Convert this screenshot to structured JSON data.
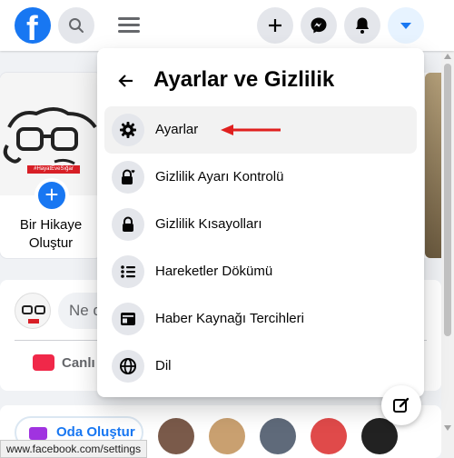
{
  "topbar": {
    "logo_letter": "f",
    "icons": {
      "search": "search-icon",
      "menu": "menu-icon",
      "create": "plus-icon",
      "messenger": "messenger-icon",
      "notifications": "bell-icon",
      "account": "caret-down-icon"
    },
    "brand_color": "#1877f2"
  },
  "panel": {
    "title": "Ayarlar ve Gizlilik",
    "back_icon": "arrow-left-icon",
    "items": [
      {
        "label": "Ayarlar",
        "icon": "gear-icon",
        "active": true
      },
      {
        "label": "Gizlilik Ayarı Kontrolü",
        "icon": "lock-heart-icon"
      },
      {
        "label": "Gizlilik Kısayolları",
        "icon": "lock-icon"
      },
      {
        "label": "Hareketler Dökümü",
        "icon": "list-icon"
      },
      {
        "label": "Haber Kaynağı Tercihleri",
        "icon": "news-feed-icon"
      },
      {
        "label": "Dil",
        "icon": "globe-icon"
      }
    ],
    "annotation_arrow_color": "#e0201f"
  },
  "stories": {
    "create_label": "Bir Hikaye Oluştur",
    "banner_text": "#HayatEveSığar"
  },
  "composer": {
    "placeholder": "Ne d",
    "live_label": "Canlı V"
  },
  "rooms": {
    "label": "Oda Oluştur"
  },
  "status_bar": {
    "url": "www.facebook.com/settings"
  }
}
